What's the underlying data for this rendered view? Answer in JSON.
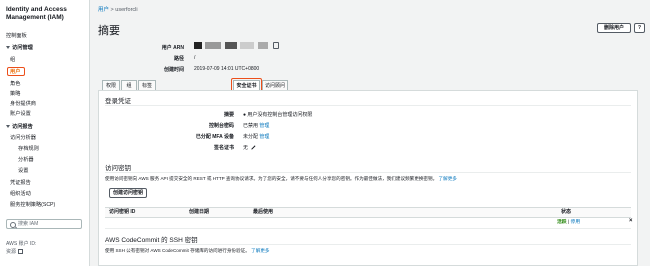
{
  "sidebar": {
    "brand": "Identity and Access Management (IAM)",
    "dashboard": "控制面板",
    "access_management": "访问管理",
    "groups": "组",
    "users": "用户",
    "roles": "角色",
    "policies": "策略",
    "identity_providers": "身份提供商",
    "account_settings": "账户设置",
    "access_reports": "访问报告",
    "access_analyzer": "访问分析器",
    "archive_rules": "存档规则",
    "analyzers": "分析器",
    "settings": "设置",
    "credential_report": "凭证报告",
    "org_activity": "组织活动",
    "scp": "服务控制策略(SCP)",
    "search_placeholder": "搜索 IAM",
    "account_id_label": "AWS 账户 ID:",
    "footer_link": "资源"
  },
  "breadcrumb": {
    "parent": "用户",
    "separator": ">",
    "current": "userforcli"
  },
  "page_title": "摘要",
  "buttons": {
    "delete_user": "删除用户",
    "help": "?",
    "create_access_key": "创建访问密钥"
  },
  "summary": {
    "arn_label": "用户 ARN",
    "path_label": "路径",
    "path_value": "/",
    "created_label": "创建时间",
    "created_value": "2019-07-09 14:01 UTC+0800"
  },
  "tabs": [
    "权限",
    "组",
    "标签",
    "安全证书",
    "访问顾问"
  ],
  "selected_tab": 3,
  "login_credentials": {
    "heading": "登录凭证",
    "summary_label": "摘要",
    "summary_value": "● 用户没有控制台管理访问权限",
    "console_password_label": "控制台密码",
    "console_password_value": "已禁用",
    "console_password_link": "管理",
    "mfa_label": "已分配 MFA 设备",
    "mfa_value": "未分配",
    "mfa_link": "管理",
    "signing_cert_label": "签名证书",
    "signing_cert_value": "无"
  },
  "access_keys": {
    "heading": "访问密钥",
    "description": "使用访问密钥向 AWS 服务 API 提交安全的 REST 或 HTTP 查询协议请求。为了您的安全，请不要与任何人分享您的密钥。作为最佳做法，我们建议频繁更换密钥。",
    "learn_more": "了解更多",
    "columns": [
      "访问密钥 ID",
      "创建日期",
      "最后使用",
      "状态"
    ],
    "row_status": "活跃",
    "row_separator": "|",
    "row_action": "停用",
    "row_delete": "×"
  },
  "ssh_keys": {
    "heading": "AWS CodeCommit 的 SSH 密钥",
    "description": "使用 SSH 公有密钥对 AWS CodeCommit 存储库的访问进行身份验证。",
    "learn_more": "了解更多"
  },
  "colors": {
    "accent_orange": "#ec7211",
    "highlight_red": "#ec4f1a",
    "link_blue": "#0073bb",
    "status_green": "#1d8102"
  }
}
